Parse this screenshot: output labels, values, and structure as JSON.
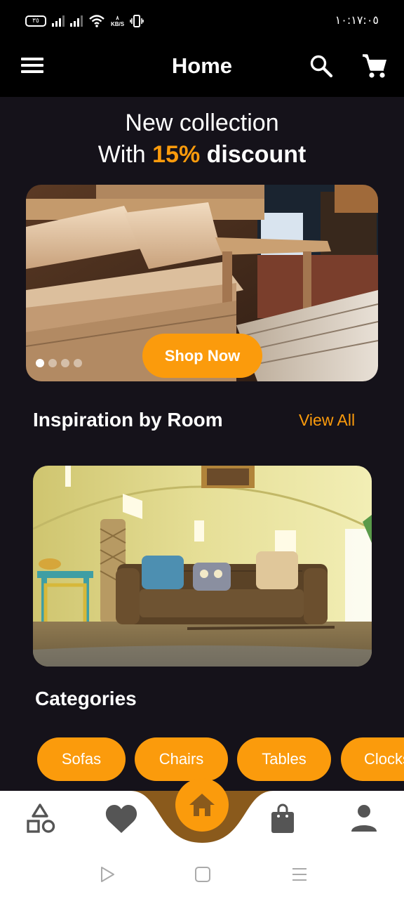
{
  "status_bar": {
    "battery": "٣٥",
    "speed_value": "٨",
    "speed_unit": "KB/S",
    "time": "١٠:١٧:٠٥"
  },
  "app_bar": {
    "title": "Home",
    "icons": [
      "menu-icon",
      "search-icon",
      "cart-icon"
    ]
  },
  "hero": {
    "line1": "New collection",
    "line2_prefix": "With ",
    "line2_accent": "15%",
    "line2_suffix": " discount",
    "cta_label": "Shop Now",
    "carousel_pages": 4,
    "carousel_active": 1
  },
  "inspiration": {
    "title": "Inspiration by Room",
    "view_all": "View All"
  },
  "categories": {
    "title": "Categories",
    "items": [
      {
        "label": "Sofas"
      },
      {
        "label": "Chairs"
      },
      {
        "label": "Tables"
      },
      {
        "label": "Clocks"
      }
    ]
  },
  "bottom_nav": {
    "items": [
      "shapes-icon",
      "heart-icon",
      "home-icon",
      "bag-icon",
      "person-icon"
    ],
    "active": "home-icon"
  },
  "system_nav": [
    "back-icon",
    "home-square-icon",
    "recents-icon"
  ],
  "colors": {
    "accent": "#fb9b0c",
    "background": "#15121a",
    "app_bar": "#000000",
    "nav_curve": "#8a5a1c",
    "nav_icon": "#555555"
  }
}
